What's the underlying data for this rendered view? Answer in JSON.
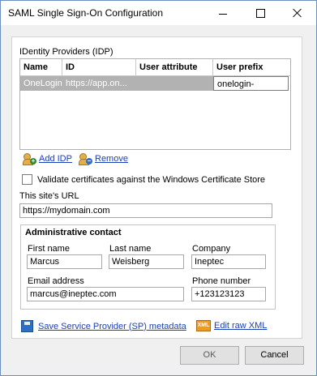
{
  "window": {
    "title": "SAML Single Sign-On Configuration"
  },
  "idp": {
    "group_label": "IDentity Providers (IDP)",
    "columns": [
      "Name",
      "ID",
      "User attribute",
      "User prefix"
    ],
    "rows": [
      {
        "name": "OneLogin",
        "id": "https://app.on...",
        "user_attribute": "",
        "user_prefix": "onelogin-"
      }
    ],
    "add_label": "Add IDP",
    "remove_label": "Remove"
  },
  "validate_cert": {
    "label": "Validate certificates against the Windows Certificate Store",
    "checked": false
  },
  "site_url": {
    "label": "This site's URL",
    "value": "https://mydomain.com"
  },
  "contact": {
    "title": "Administrative contact",
    "first_name_label": "First name",
    "first_name": "Marcus",
    "last_name_label": "Last name",
    "last_name": "Weisberg",
    "company_label": "Company",
    "company": "Ineptec",
    "email_label": "Email address",
    "email": "marcus@ineptec.com",
    "phone_label": "Phone number",
    "phone": "+123123123"
  },
  "links": {
    "save_metadata": "Save Service Provider (SP) metadata",
    "edit_xml": "Edit raw XML",
    "xml_badge": "XML"
  },
  "buttons": {
    "ok": "OK",
    "cancel": "Cancel"
  }
}
